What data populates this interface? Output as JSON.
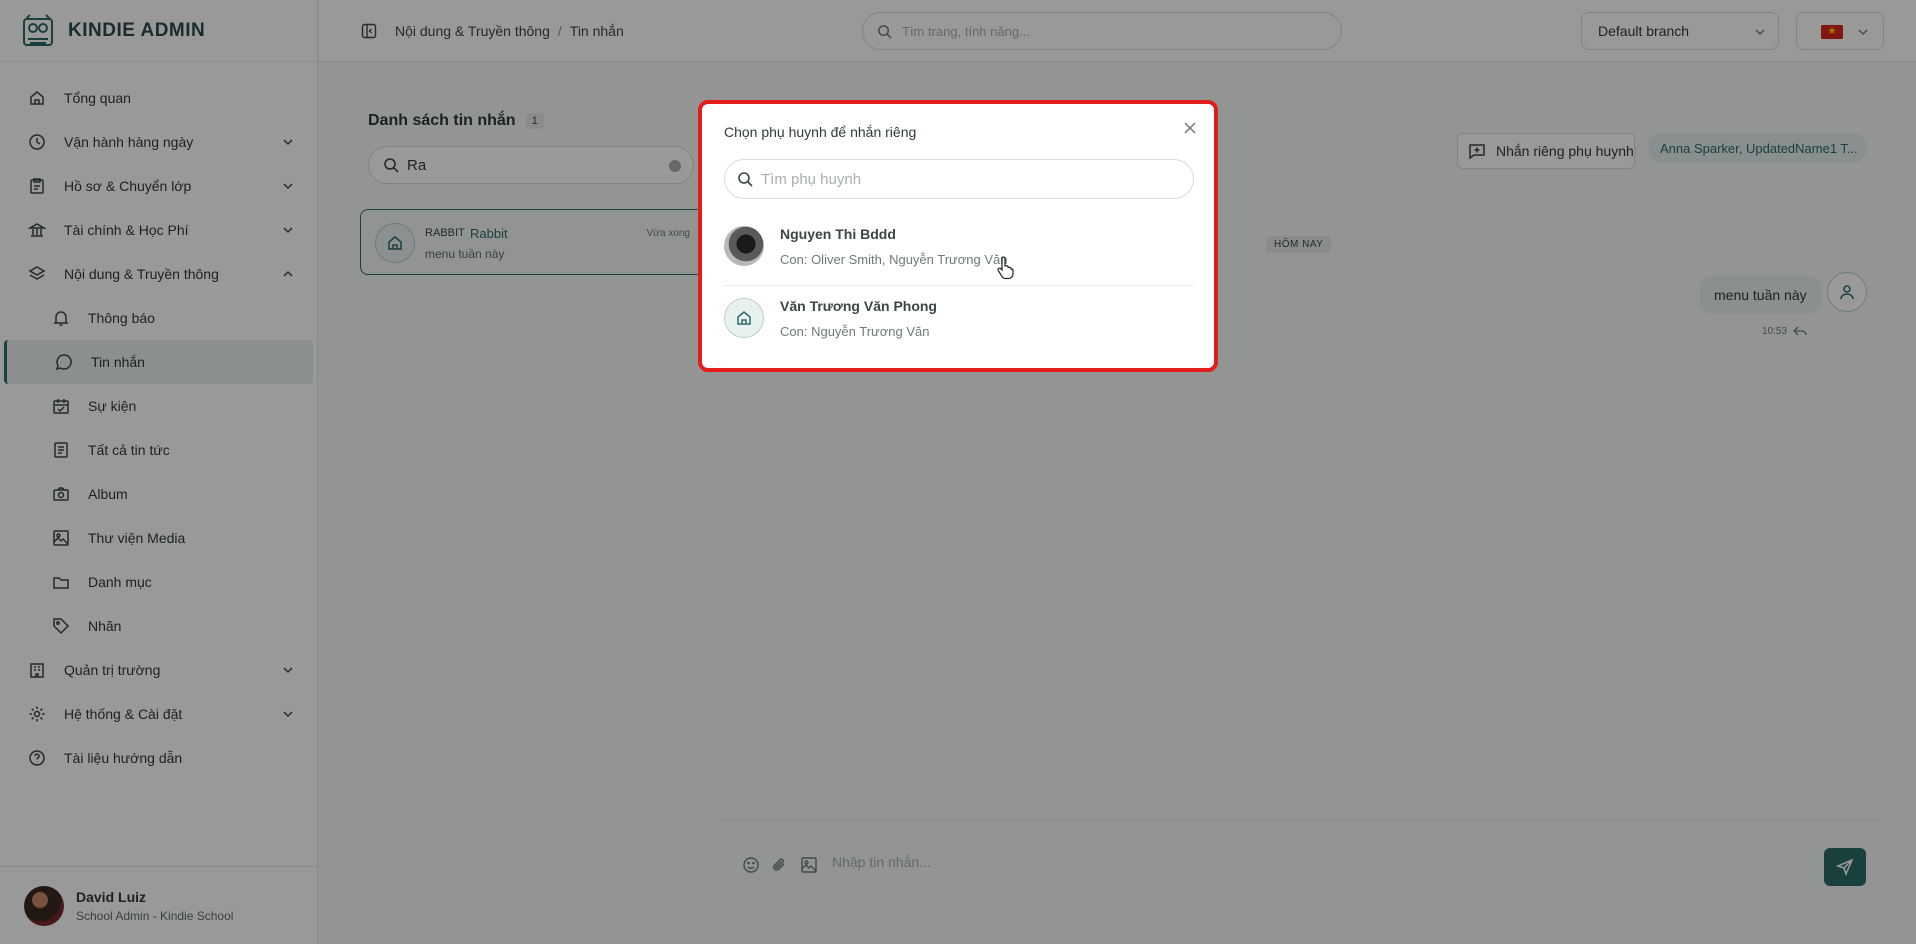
{
  "brand": {
    "name": "KINDIE ADMIN"
  },
  "sidebar": {
    "items": [
      {
        "label": "Tổng quan",
        "icon": "home-icon"
      },
      {
        "label": "Vận hành hàng ngày",
        "icon": "clock-icon"
      },
      {
        "label": "Hồ sơ & Chuyển lớp",
        "icon": "clipboard-icon"
      },
      {
        "label": "Tài chính & Học Phí",
        "icon": "bank-icon"
      },
      {
        "label": "Nội dung & Truyền thông",
        "icon": "layers-icon"
      },
      {
        "label": "Quản trị trường",
        "icon": "building-icon"
      },
      {
        "label": "Hệ thống & Cài đặt",
        "icon": "gear-icon"
      },
      {
        "label": "Tài liệu hướng dẫn",
        "icon": "help-icon"
      }
    ],
    "subitems": [
      {
        "label": "Thông báo",
        "icon": "bell-icon"
      },
      {
        "label": "Tin nhắn",
        "icon": "chat-icon",
        "active": true
      },
      {
        "label": "Sự kiện",
        "icon": "calendar-icon"
      },
      {
        "label": "Tất cả tin tức",
        "icon": "newspaper-icon"
      },
      {
        "label": "Album",
        "icon": "camera-icon"
      },
      {
        "label": "Thư viện Media",
        "icon": "image-icon"
      },
      {
        "label": "Danh mục",
        "icon": "folder-icon"
      },
      {
        "label": "Nhãn",
        "icon": "tag-icon"
      }
    ]
  },
  "user": {
    "name": "David Luiz",
    "role": "School Admin - Kindie School"
  },
  "topbar": {
    "breadcrumb": [
      "Nội dung & Truyền thông",
      "Tin nhắn"
    ],
    "search_placeholder": "Tìm trang, tính năng...",
    "branch": "Default branch",
    "flag_color": "#d9251d"
  },
  "messages": {
    "title": "Danh sách tin nhắn",
    "count": "1",
    "search_value": "Ra",
    "conversation": {
      "tag": "RABBIT",
      "name": "Rabbit",
      "time": "Vừa xong",
      "preview": "menu tuần này"
    },
    "private_button": "Nhắn riêng phụ huynh",
    "recipients": "Anna Sparker, UpdatedName1 T...",
    "day_separator": "HÔM NAY",
    "bubble_text": "menu tuần này",
    "bubble_time": "10:53",
    "composer_placeholder": "Nhập tin nhắn..."
  },
  "modal": {
    "title": "Chọn phụ huynh để nhắn riêng",
    "search_placeholder": "Tìm phụ huynh",
    "parents": [
      {
        "name": "Nguyen Thi Bddd",
        "children": "Con: Oliver Smith, Nguyễn Trương Văn"
      },
      {
        "name": "Văn Trương Văn Phong",
        "children": "Con: Nguyễn Trương Văn"
      }
    ]
  },
  "colors": {
    "accent": "#2c6b68",
    "highlight_border": "#e21b1b"
  }
}
